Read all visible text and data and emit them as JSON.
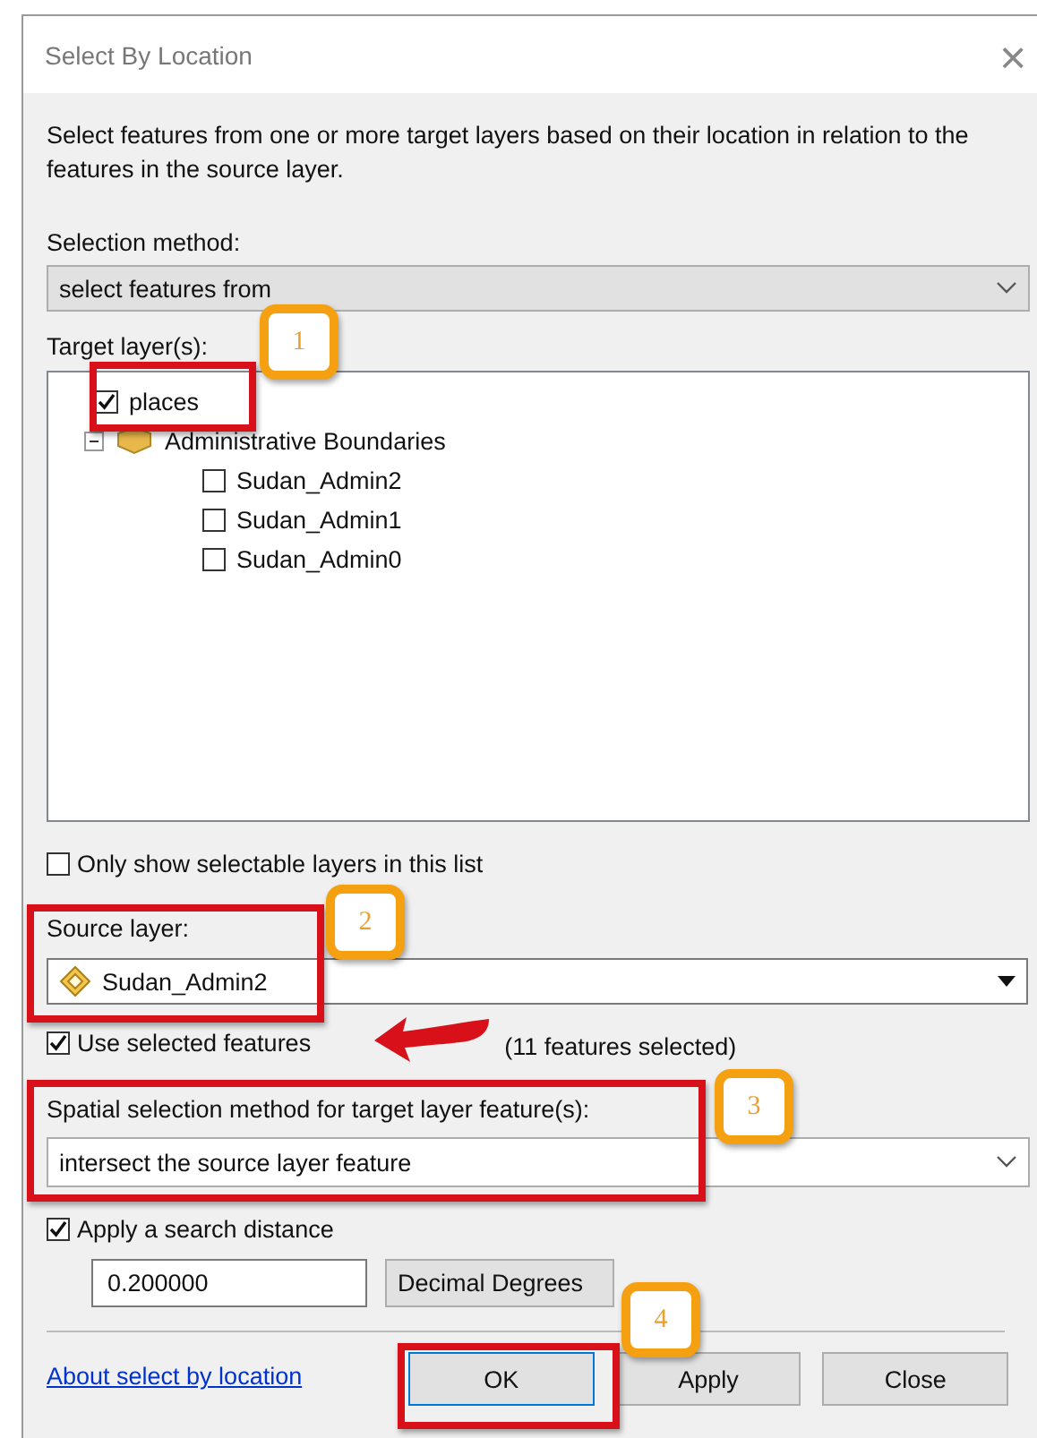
{
  "window": {
    "title": "Select By Location",
    "close_glyph": "×"
  },
  "description": "Select features from one or more target layers based on their location in relation to the features in the source layer.",
  "selection_method": {
    "label": "Selection method:",
    "value": "select features from"
  },
  "target_layers": {
    "label": "Target layer(s):",
    "items": [
      {
        "name": "places",
        "kind": "layer",
        "checked": true
      },
      {
        "name": "Administrative Boundaries",
        "kind": "group",
        "expanded": true,
        "children": [
          {
            "name": "Sudan_Admin2",
            "kind": "layer",
            "checked": false
          },
          {
            "name": "Sudan_Admin1",
            "kind": "layer",
            "checked": false
          },
          {
            "name": "Sudan_Admin0",
            "kind": "layer",
            "checked": false
          }
        ]
      }
    ]
  },
  "only_selectable": {
    "label": "Only show selectable layers in this list",
    "checked": false
  },
  "source_layer": {
    "label": "Source layer:",
    "value": "Sudan_Admin2"
  },
  "use_selected": {
    "label": "Use selected features",
    "checked": true,
    "count": "(11 features selected)"
  },
  "spatial_method": {
    "label": "Spatial selection method for target layer feature(s):",
    "value": "intersect the source layer feature"
  },
  "search_distance": {
    "label": "Apply a search distance",
    "checked": true,
    "value": "0.200000",
    "units": "Decimal Degrees"
  },
  "link": "About select by location",
  "buttons": [
    {
      "label": "OK",
      "kind": "default"
    },
    {
      "label": "Apply",
      "kind": "normal"
    },
    {
      "label": "Close",
      "kind": "normal"
    }
  ],
  "annotations": [
    {
      "kind": "frame"
    },
    {
      "kind": "callout",
      "number": "1"
    },
    {
      "kind": "frame"
    },
    {
      "kind": "callout",
      "number": "2"
    },
    {
      "kind": "arrow"
    },
    {
      "kind": "frame"
    },
    {
      "kind": "callout",
      "number": "3"
    },
    {
      "kind": "frame"
    },
    {
      "kind": "callout",
      "number": "4"
    }
  ]
}
